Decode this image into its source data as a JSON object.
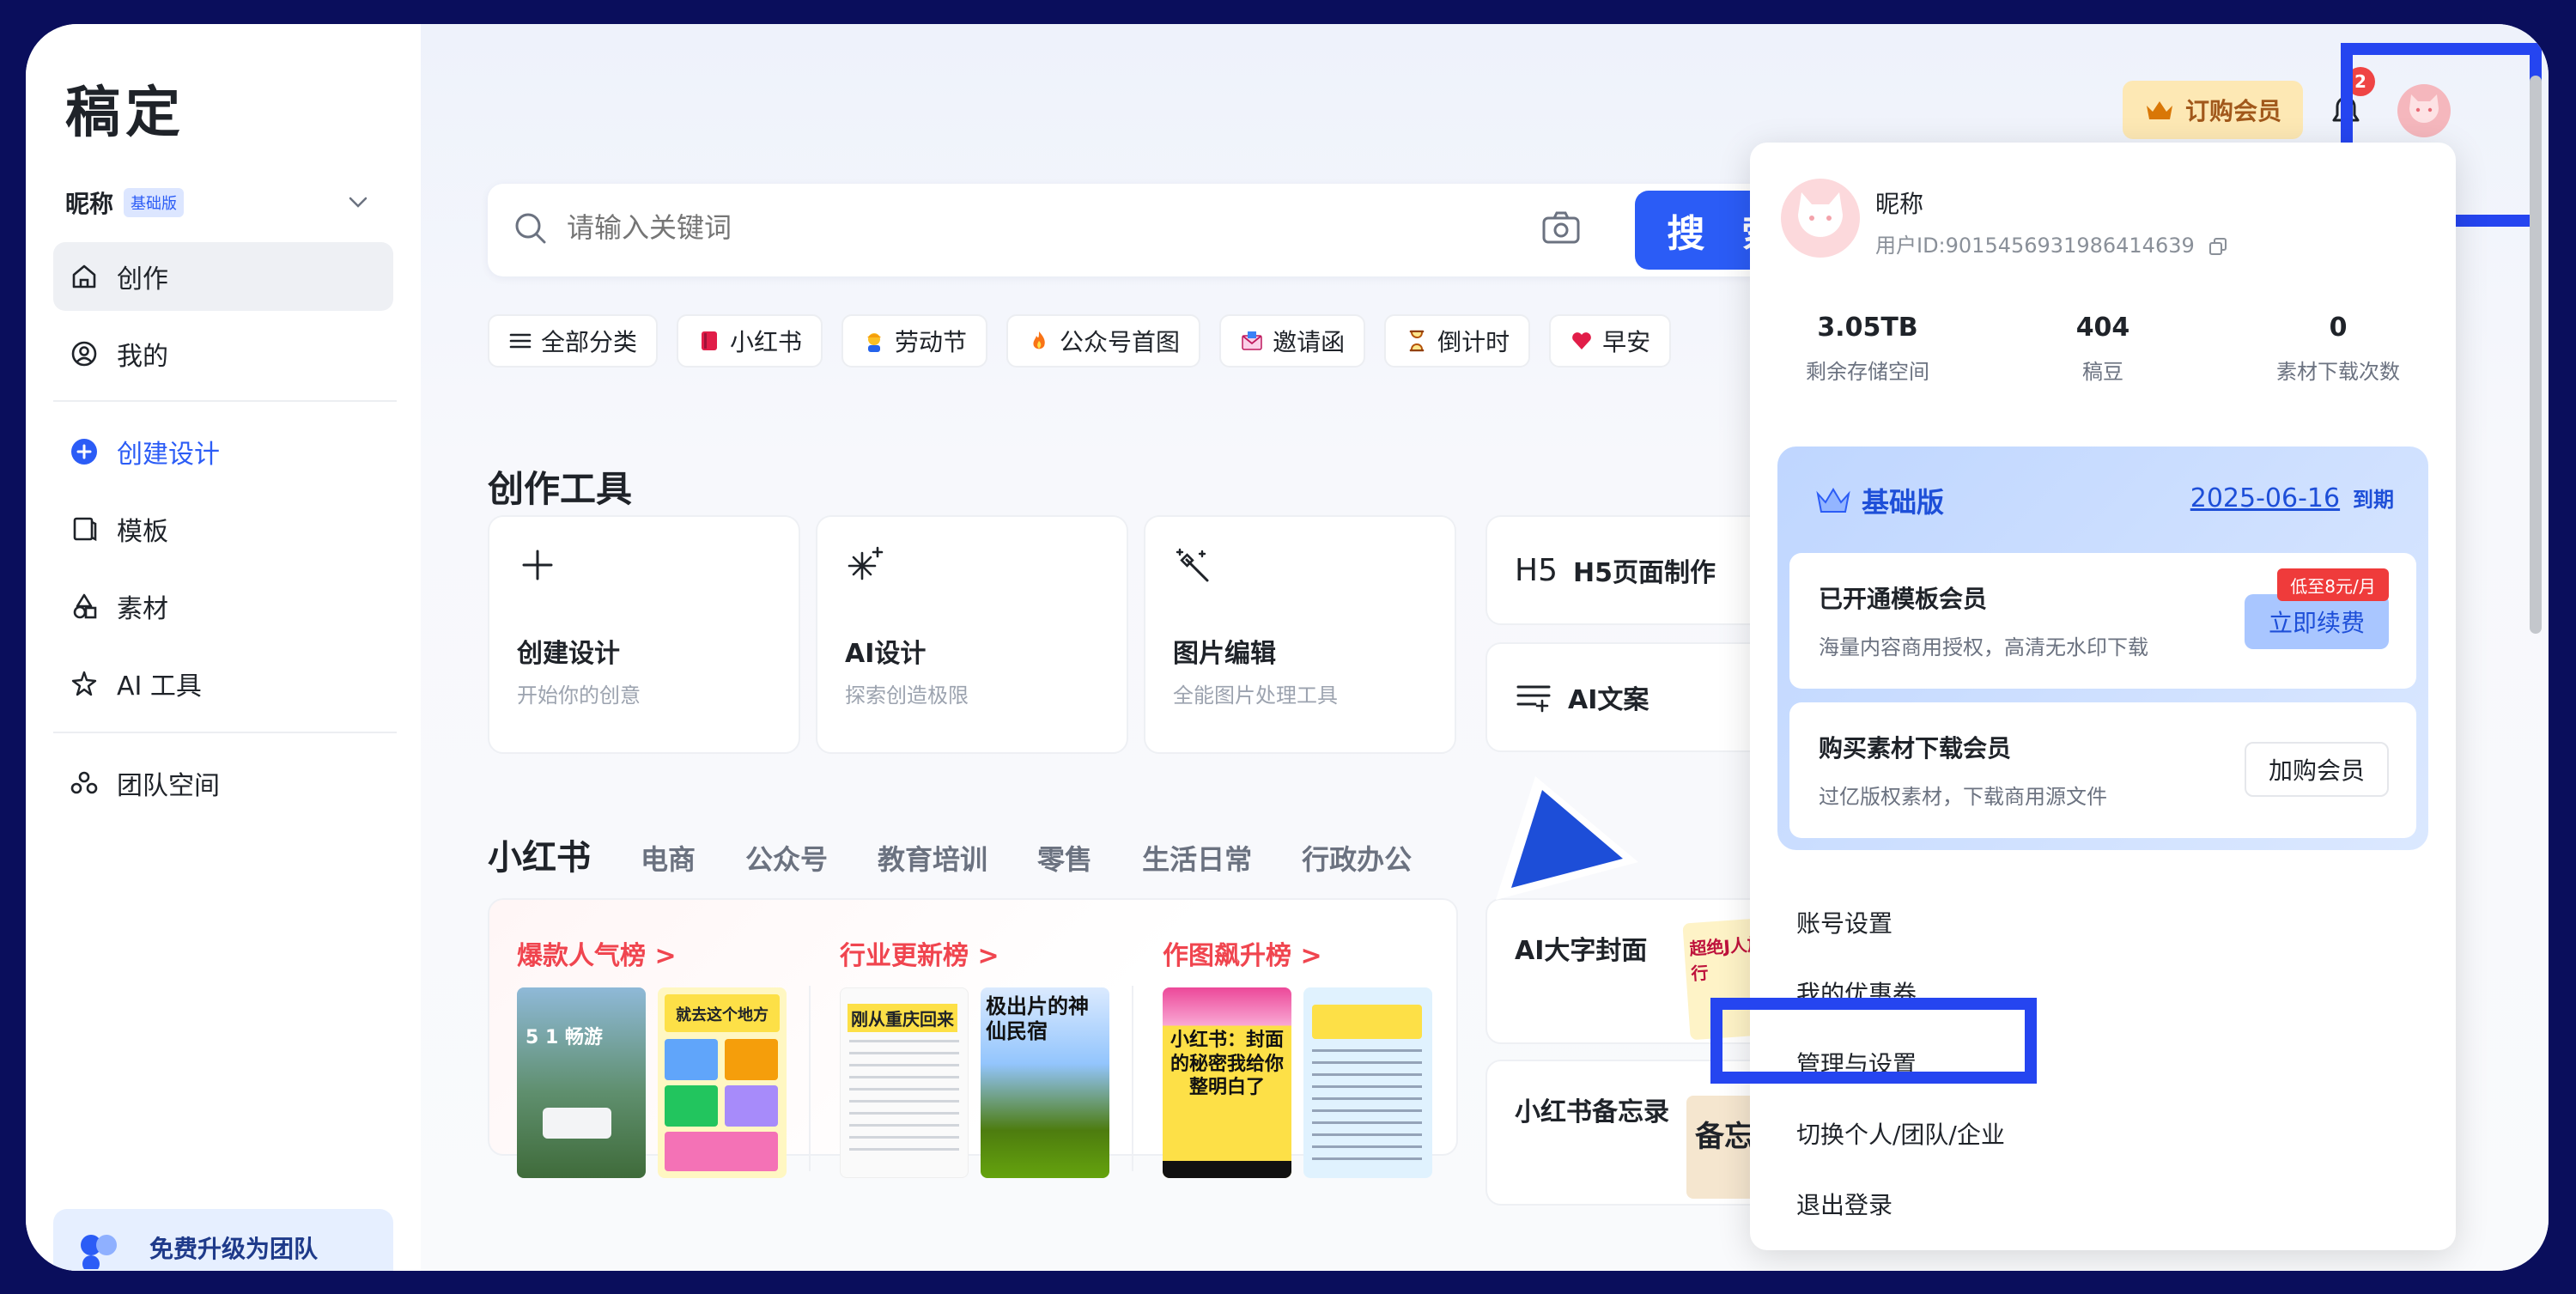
{
  "brand": "稿定",
  "user": {
    "nickname": "昵称",
    "tier": "基础版"
  },
  "sidebar": {
    "items": [
      {
        "label": "创作"
      },
      {
        "label": "我的"
      },
      {
        "label": "创建设计"
      },
      {
        "label": "模板"
      },
      {
        "label": "素材"
      },
      {
        "label": "AI 工具"
      },
      {
        "label": "团队空间"
      }
    ],
    "team_upgrade": "免费升级为团队"
  },
  "search": {
    "placeholder": "请输入关键词",
    "button": "搜 索"
  },
  "chips": [
    {
      "label": "全部分类",
      "icon": "menu-icon"
    },
    {
      "label": "小红书",
      "icon": "notebook-icon"
    },
    {
      "label": "劳动节",
      "icon": "worker-icon"
    },
    {
      "label": "公众号首图",
      "icon": "flame-icon"
    },
    {
      "label": "邀请函",
      "icon": "envelope-icon"
    },
    {
      "label": "倒计时",
      "icon": "hourglass-icon"
    },
    {
      "label": "早安",
      "icon": "heart-icon"
    }
  ],
  "tools": {
    "title": "创作工具",
    "cards": [
      {
        "title": "创建设计",
        "desc": "开始你的创意",
        "icon": "plus-icon"
      },
      {
        "title": "AI设计",
        "desc": "探索创造极限",
        "icon": "sparkle-icon"
      },
      {
        "title": "图片编辑",
        "desc": "全能图片处理工具",
        "icon": "magic-wand-icon"
      }
    ],
    "small": [
      {
        "title": "H5页面制作",
        "icon": "h5-icon"
      },
      {
        "title": "AI文案",
        "icon": "text-lines-icon"
      }
    ]
  },
  "tabs": [
    "小红书",
    "电商",
    "公众号",
    "教育培训",
    "零售",
    "生活日常",
    "行政办公"
  ],
  "rankings": [
    {
      "title": "爆款人气榜 >"
    },
    {
      "title": "行业更新榜 >"
    },
    {
      "title": "作图飙升榜 >"
    }
  ],
  "thumbs": {
    "a1": "5 1 畅游",
    "a2": "就去这个地方",
    "b1": "刚从重庆回来",
    "b2": "极出片的神仙民宿",
    "c1": "小红书：封面的秘密我给你整明白了",
    "c2": ""
  },
  "side_cards": [
    {
      "title": "AI大字封面",
      "thumb": "超绝J人旅行"
    },
    {
      "title": "小红书备忘录",
      "thumb": "备忘"
    }
  ],
  "header": {
    "member_button": "订购会员",
    "notif_count": "2"
  },
  "popup": {
    "nickname": "昵称",
    "user_id": "用户ID:9015456931986414639",
    "stats": [
      {
        "value": "3.05TB",
        "label": "剩余存储空间"
      },
      {
        "value": "404",
        "label": "稿豆"
      },
      {
        "value": "0",
        "label": "素材下载次数"
      }
    ],
    "vip": {
      "title": "基础版",
      "expire_date": "2025-06-16",
      "expire_suffix": "到期",
      "card1": {
        "title": "已开通模板会员",
        "desc": "海量内容商用授权，高清无水印下载",
        "button": "立即续费",
        "promo": "低至8元/月"
      },
      "card2": {
        "title": "购买素材下载会员",
        "desc": "过亿版权素材，下载商用源文件",
        "button": "加购会员"
      }
    },
    "menu": [
      "账号设置",
      "我的优惠券",
      "管理与设置",
      "切换个人/团队/企业",
      "退出登录"
    ]
  },
  "colors": {
    "accent": "#2b5cf6",
    "highlight": "#2545f0",
    "rank_red": "#f0454f",
    "frame": "#0a0e5c"
  }
}
